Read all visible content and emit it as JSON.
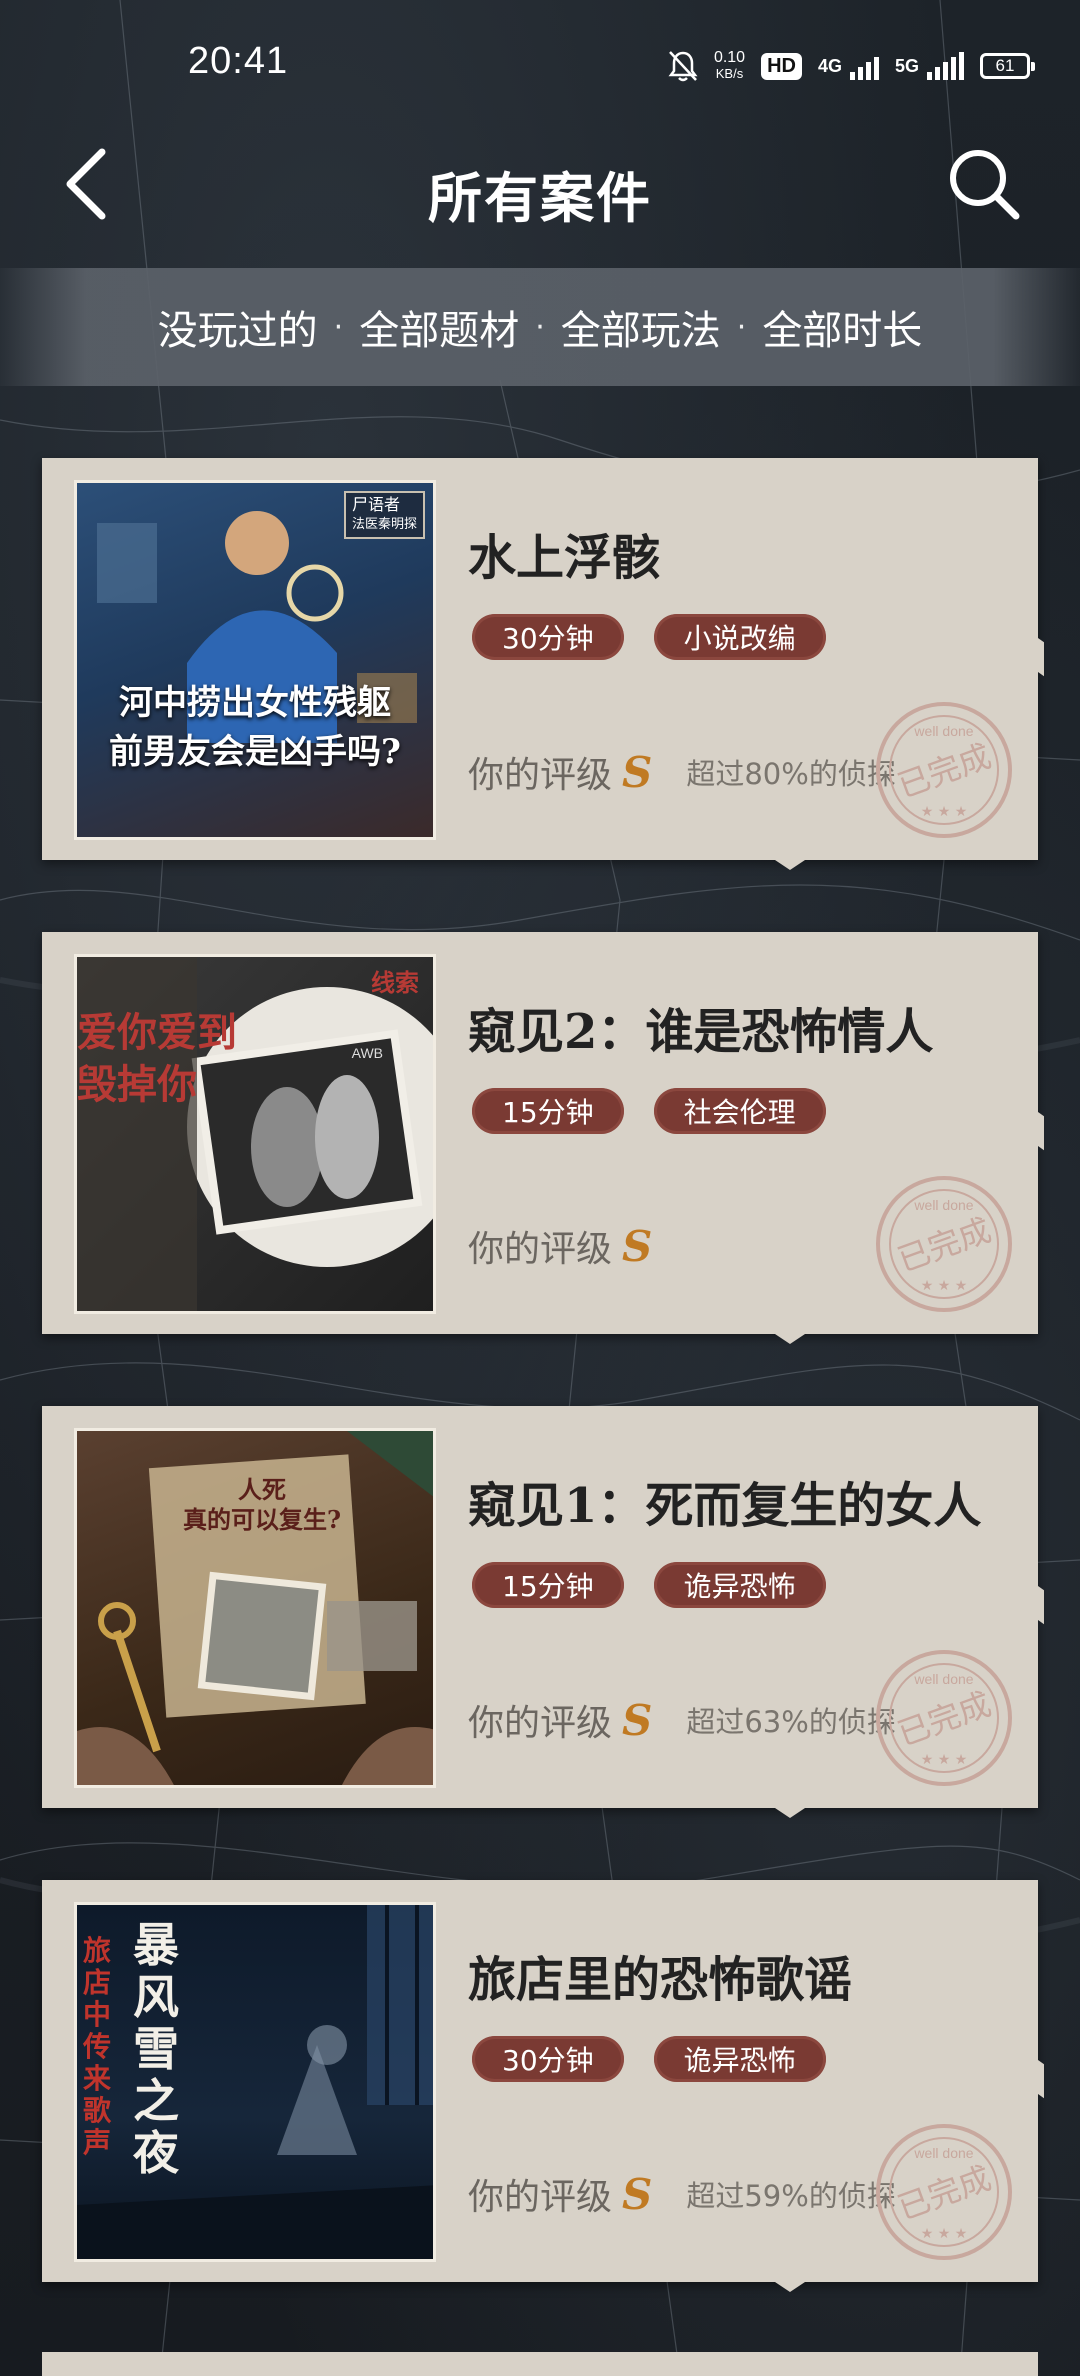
{
  "status_bar": {
    "time": "20:41",
    "net_speed_value": "0.10",
    "net_speed_unit": "KB/s",
    "hd_badge": "HD",
    "net_4g": "4G",
    "net_5g": "5G",
    "battery": "61"
  },
  "header": {
    "title": "所有案件",
    "back_icon": "chevron-left-icon",
    "search_icon": "search-icon"
  },
  "filters": [
    {
      "label": "没玩过的"
    },
    {
      "label": "全部题材"
    },
    {
      "label": "全部玩法"
    },
    {
      "label": "全部时长"
    }
  ],
  "filter_separator": "·",
  "cases": [
    {
      "title": "水上浮骸",
      "duration": "30分钟",
      "genre": "小说改编",
      "rating_label": "你的评级",
      "grade": "S",
      "percentile": "超过80%的侦探",
      "cover_caption_line1": "河中捞出女性残躯",
      "cover_caption_line2": "前男友会是凶手吗?",
      "cover_badge_line1": "尸语者",
      "cover_badge_line2": "法医秦明探"
    },
    {
      "title": "窥见2：谁是恐怖情人",
      "duration": "15分钟",
      "genre": "社会伦理",
      "rating_label": "你的评级",
      "grade": "S",
      "percentile": "",
      "cover_caption_line1": "爱你爱到",
      "cover_caption_line2": "毁掉你",
      "cover_badge_line1": "线索",
      "cover_badge_line2": "AWB"
    },
    {
      "title": "窥见1：死而复生的女人",
      "duration": "15分钟",
      "genre": "诡异恐怖",
      "rating_label": "你的评级",
      "grade": "S",
      "percentile": "超过63%的侦探",
      "cover_caption_line1": "人死",
      "cover_caption_line2": "真的可以复生?",
      "cover_badge_line1": "",
      "cover_badge_line2": ""
    },
    {
      "title": "旅店里的恐怖歌谣",
      "duration": "30分钟",
      "genre": "诡异恐怖",
      "rating_label": "你的评级",
      "grade": "S",
      "percentile": "超过59%的侦探",
      "cover_caption_line1": "暴风雪之夜",
      "cover_caption_line2": "旅店中传来歌声",
      "cover_badge_line1": "",
      "cover_badge_line2": ""
    }
  ],
  "stamp": {
    "top_text": "well done",
    "main_text": "已完成",
    "stars": "★ ★ ★"
  },
  "colors": {
    "card_bg": "#d8d2c8",
    "tag_bg": "#7a3a33",
    "grade": "#c07a23",
    "stamp": "#c8a89e"
  }
}
